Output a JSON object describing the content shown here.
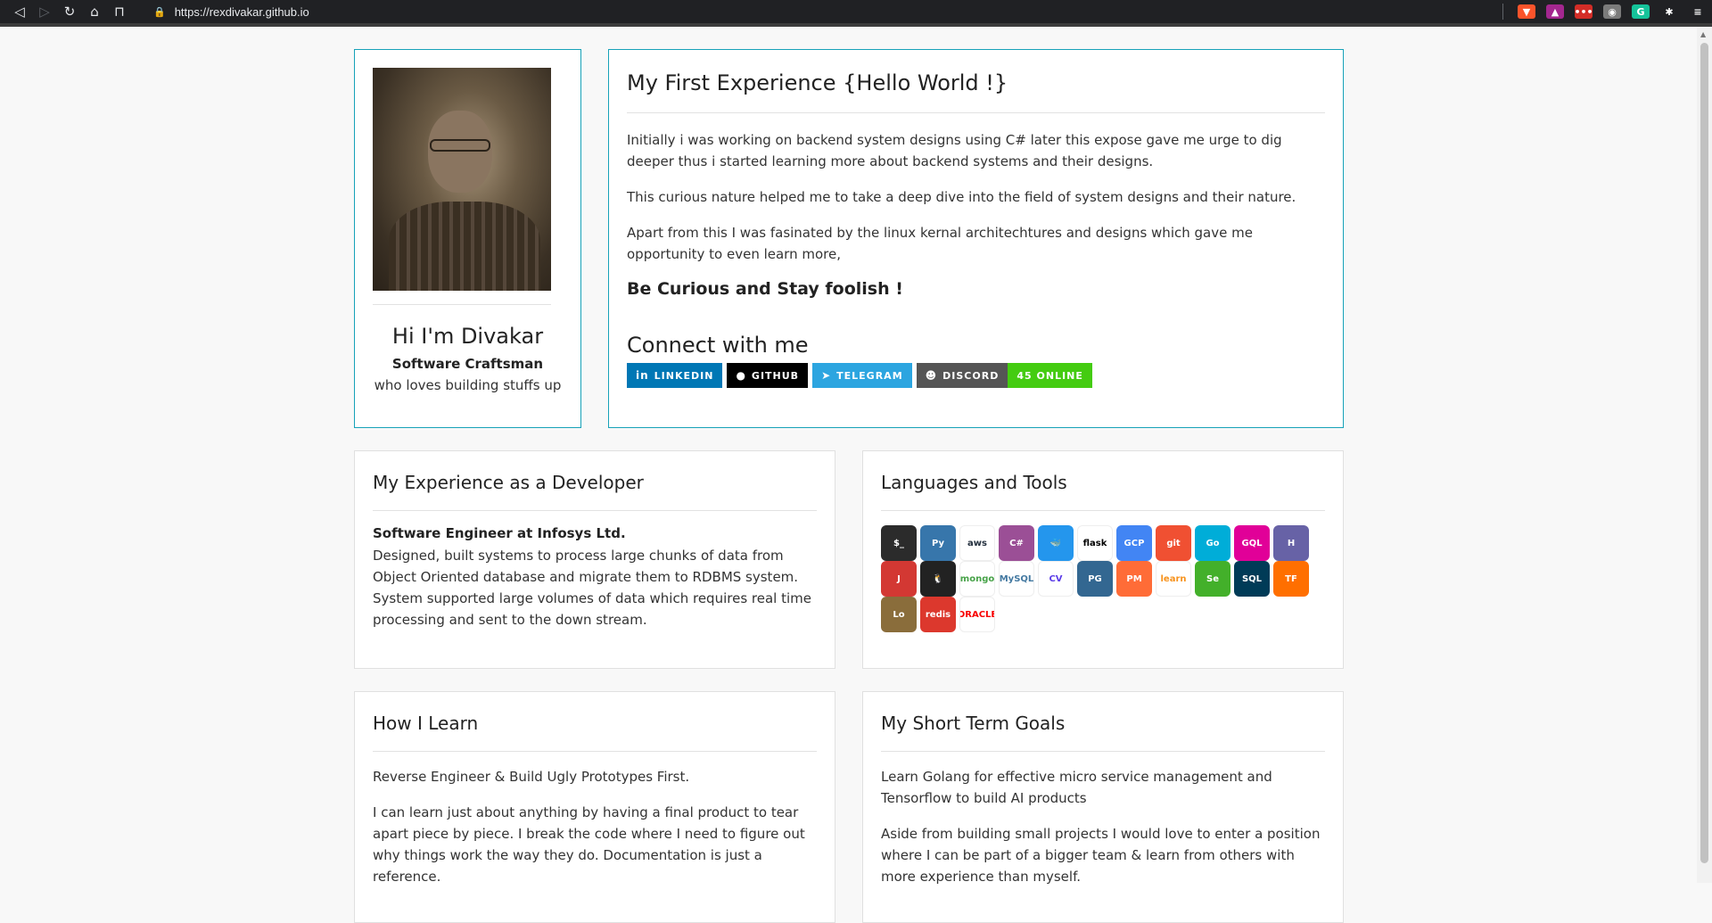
{
  "browser": {
    "url": "https://rexdivakar.github.io",
    "nav_icons": [
      "back-icon",
      "forward-icon",
      "reload-icon",
      "home-icon",
      "bookmark-icon"
    ],
    "extensions": [
      {
        "name": "brave-icon",
        "color": "#fb542b",
        "glyph": "▼"
      },
      {
        "name": "brave-rewards-icon",
        "color": "#a3278f",
        "glyph": "▲"
      },
      {
        "name": "lastpass-icon",
        "color": "#d32d27",
        "glyph": "•••"
      },
      {
        "name": "extension-icon",
        "color": "#7b7b7b",
        "glyph": "◉"
      },
      {
        "name": "grammarly-icon",
        "color": "#15c39a",
        "glyph": "G"
      },
      {
        "name": "puzzle-icon",
        "color": "#202124",
        "glyph": "✱"
      },
      {
        "name": "menu-icon",
        "color": "#202124",
        "glyph": "≡"
      }
    ]
  },
  "profile": {
    "photo_alt": "profile-photo",
    "name": "Hi I'm Divakar",
    "role": "Software Craftsman",
    "tagline": "who loves building stuffs up"
  },
  "intro": {
    "title": "My First Experience {Hello World !}",
    "p1": "Initially i was working on backend system designs using C# later this expose gave me urge to dig deeper thus i started learning more about backend systems and their designs.",
    "p2": "This curious nature helped me to take a deep dive into the field of system designs and their nature.",
    "p3": "Apart from this I was fasinated by the linux kernal architechtures and designs which gave me opportunity to even learn more,",
    "motto": "Be Curious and Stay foolish !",
    "connect": "Connect with me",
    "badges": {
      "linkedin": "LINKEDIN",
      "github": "GITHUB",
      "telegram": "TELEGRAM",
      "discord": "DISCORD",
      "online": "45 ONLINE"
    }
  },
  "experience": {
    "title": "My Experience as a Developer",
    "job": "Software Engineer at Infosys Ltd.",
    "description": "Designed, built systems to process large chunks of data from Object Oriented database and migrate them to RDBMS system. System supported large volumes of data which requires real time processing and sent to the down stream."
  },
  "tools": {
    "title": "Languages and Tools",
    "icons": [
      {
        "name": "bash-icon",
        "bg": "#2b2b2b",
        "label": "$_"
      },
      {
        "name": "python-icon",
        "bg": "#3776ab",
        "label": "Py"
      },
      {
        "name": "aws-icon",
        "bg": "#ffffff",
        "label": "aws",
        "fg": "#232f3e"
      },
      {
        "name": "csharp-icon",
        "bg": "#9b4f96",
        "label": "C#"
      },
      {
        "name": "docker-icon",
        "bg": "#2496ed",
        "label": "🐳"
      },
      {
        "name": "flask-icon",
        "bg": "#ffffff",
        "label": "flask",
        "fg": "#000"
      },
      {
        "name": "gcp-icon",
        "bg": "#4285f4",
        "label": "GCP"
      },
      {
        "name": "git-icon",
        "bg": "#f05032",
        "label": "git"
      },
      {
        "name": "go-icon",
        "bg": "#00add8",
        "label": "Go"
      },
      {
        "name": "graphql-icon",
        "bg": "#e10098",
        "label": "GQL"
      },
      {
        "name": "heroku-icon",
        "bg": "#6762a6",
        "label": "H"
      },
      {
        "name": "jenkins-icon",
        "bg": "#d33833",
        "label": "J"
      },
      {
        "name": "linux-icon",
        "bg": "#222222",
        "label": "🐧"
      },
      {
        "name": "mongodb-icon",
        "bg": "#ffffff",
        "label": "mongo",
        "fg": "#47a248"
      },
      {
        "name": "mysql-icon",
        "bg": "#ffffff",
        "label": "MySQL",
        "fg": "#4479a1"
      },
      {
        "name": "opencv-icon",
        "bg": "#ffffff",
        "label": "CV",
        "fg": "#5c3ee8"
      },
      {
        "name": "postgresql-icon",
        "bg": "#336791",
        "label": "PG"
      },
      {
        "name": "postman-icon",
        "bg": "#ff6c37",
        "label": "PM"
      },
      {
        "name": "scikit-learn-icon",
        "bg": "#ffffff",
        "label": "learn",
        "fg": "#f7931e"
      },
      {
        "name": "selenium-icon",
        "bg": "#43b02a",
        "label": "Se"
      },
      {
        "name": "sqlite-icon",
        "bg": "#003b57",
        "label": "SQL"
      },
      {
        "name": "tensorflow-icon",
        "bg": "#ff6f00",
        "label": "TF"
      },
      {
        "name": "locust-icon",
        "bg": "#8a6d3b",
        "label": "Lo"
      },
      {
        "name": "redis-icon",
        "bg": "#dc382d",
        "label": "redis"
      },
      {
        "name": "oracle-icon",
        "bg": "#ffffff",
        "label": "ORACLE",
        "fg": "#f80000"
      }
    ]
  },
  "learn": {
    "title": "How I Learn",
    "p1": "Reverse Engineer & Build Ugly Prototypes First.",
    "p2": "I can learn just about anything by having a final product to tear apart piece by piece. I break the code where I need to figure out why things work the way they do. Documentation is just a reference."
  },
  "goals": {
    "title": "My Short Term Goals",
    "p1": "Learn Golang for effective micro service management and Tensorflow to build AI products",
    "p2": "Aside from building small projects I would love to enter a position where I can be part of a bigger team & learn from others with more experience than myself."
  }
}
